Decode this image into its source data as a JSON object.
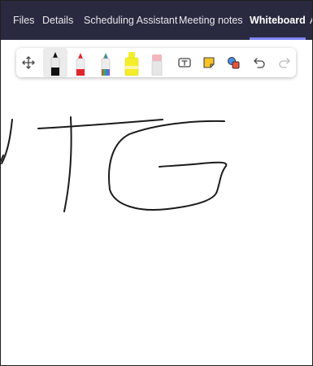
{
  "tabs": [
    {
      "label": "Files"
    },
    {
      "label": "Details"
    },
    {
      "label": "Scheduling Assistant"
    },
    {
      "label": "Meeting notes"
    },
    {
      "label": "Whiteboard",
      "active": true
    },
    {
      "label": "A"
    }
  ],
  "toolbar": {
    "tools": [
      {
        "icon": "move-icon"
      },
      {
        "icon": "black-pen-icon",
        "selected": true
      },
      {
        "icon": "red-pen-icon"
      },
      {
        "icon": "rainbow-pen-icon"
      },
      {
        "icon": "highlighter-icon"
      },
      {
        "icon": "eraser-icon"
      },
      {
        "icon": "text-box-icon"
      },
      {
        "icon": "sticky-note-icon"
      },
      {
        "icon": "shapes-icon"
      },
      {
        "icon": "undo-icon"
      },
      {
        "icon": "redo-icon"
      }
    ]
  },
  "colors": {
    "tabbar_bg": "#292a3f",
    "active_underline": "#7f85f5",
    "ink": "#1b1b1b",
    "pen_red": "#e0262c",
    "highlighter_yellow": "#f4ee2a",
    "sticky_yellow": "#f7c325",
    "eraser_pink": "#f3b6bd"
  },
  "canvas": {
    "ink_text": "tG"
  }
}
